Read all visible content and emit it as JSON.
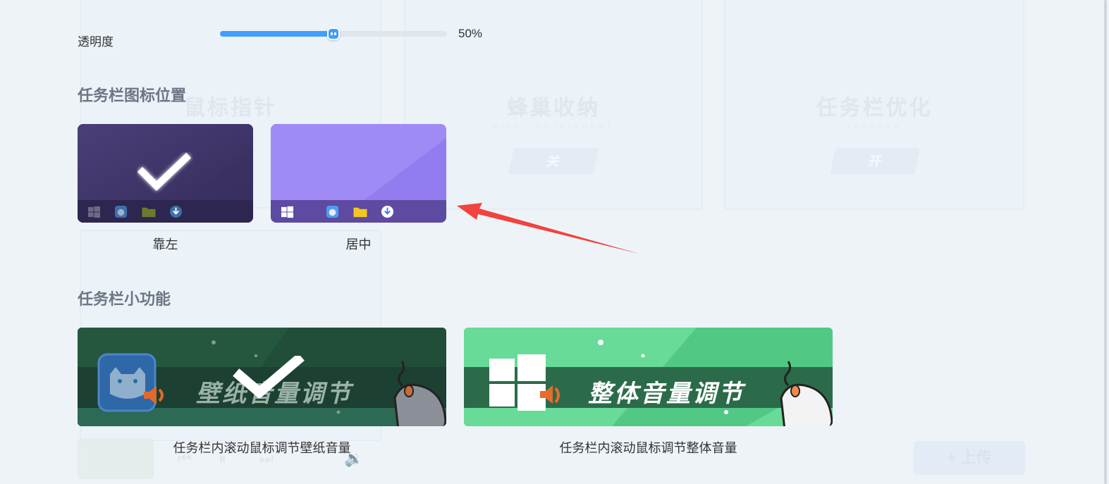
{
  "transparency": {
    "label": "透明度",
    "percent": 50,
    "value_text": "50%"
  },
  "taskbar_position": {
    "title": "任务栏图标位置",
    "options": [
      {
        "label": "靠左",
        "selected": true
      },
      {
        "label": "居中",
        "selected": false
      }
    ]
  },
  "taskbar_features": {
    "title": "任务栏小功能",
    "items": [
      {
        "banner": "壁纸音量调节",
        "caption": "任务栏内滚动鼠标调节壁纸音量",
        "selected": true
      },
      {
        "banner": "整体音量调节",
        "caption": "任务栏内滚动鼠标调节整体音量",
        "selected": false
      }
    ]
  },
  "background": {
    "cards": [
      {
        "title": "鼠标指针",
        "sub": ""
      },
      {
        "title": "蜂巢收纳",
        "sub": "HIVE CONTAINMENT",
        "toggle": "关"
      },
      {
        "title": "任务栏优化",
        "sub": "TASKBAR",
        "toggle": "开"
      }
    ],
    "upload_label": "+ 上传"
  },
  "colors": {
    "accent": "#409eff",
    "left_card": "#3f3668",
    "center_card": "#9b84f3",
    "wallpaper_card": "#23513e",
    "system_card": "#5fd392",
    "annotation_arrow": "#f2433d"
  }
}
